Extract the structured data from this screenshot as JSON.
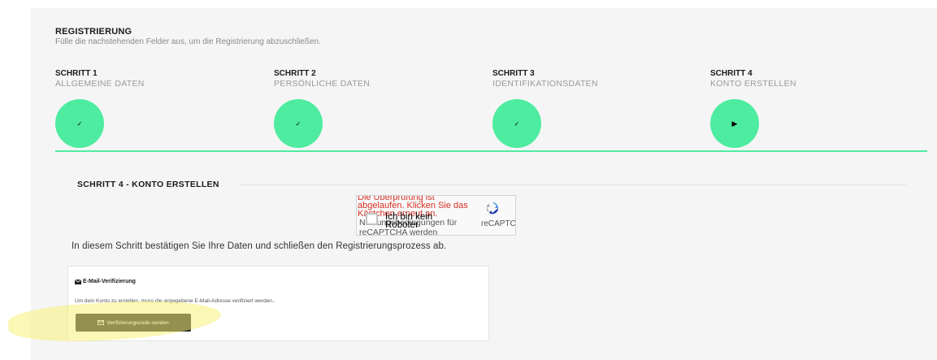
{
  "header": {
    "title": "REGISTRIERUNG",
    "subtitle": "Fülle die nachstehenden Felder aus, um die Registrierung abzuschließen."
  },
  "steps": [
    {
      "number": "SCHRITT 1",
      "label": "ALLGEMEINE DATEN",
      "icon": "check-icon",
      "glyph": "✓",
      "status": "done"
    },
    {
      "number": "SCHRITT 2",
      "label": "PERSÖNLICHE DATEN",
      "icon": "check-icon",
      "glyph": "✓",
      "status": "done"
    },
    {
      "number": "SCHRITT 3",
      "label": "IDENTIFIKATIONSDATEN",
      "icon": "check-icon",
      "glyph": "✓",
      "status": "done"
    },
    {
      "number": "SCHRITT 4",
      "label": "KONTO ERSTELLEN",
      "icon": "play-icon",
      "glyph": "▶",
      "status": "current"
    }
  ],
  "section": {
    "title": "SCHRITT 4 - KONTO ERSTELLEN",
    "description": "In diesem Schritt bestätigen Sie Ihre Daten und schließen den Registrierungsprozess ab."
  },
  "captcha": {
    "error": "Die Überprüfung ist abgelaufen. Klicken Sie das Kästchen erneut an.",
    "checkbox_label": "Ich bin kein Roboter",
    "terms": "Nutzungsbedingungen für reCAPTCHA werden",
    "brand": "reCAPTC"
  },
  "verification": {
    "heading": "E-Mail-Verifizierung",
    "text": "Um dein Konto zu erstellen, muss die angegebene E-Mail-Adresse verifiziert werden..",
    "button_label": "Verifizierungscode senden"
  },
  "colors": {
    "accent": "#4eeca0",
    "error": "#d93025",
    "button": "#1c1c1c",
    "highlight": "#f7f078"
  }
}
